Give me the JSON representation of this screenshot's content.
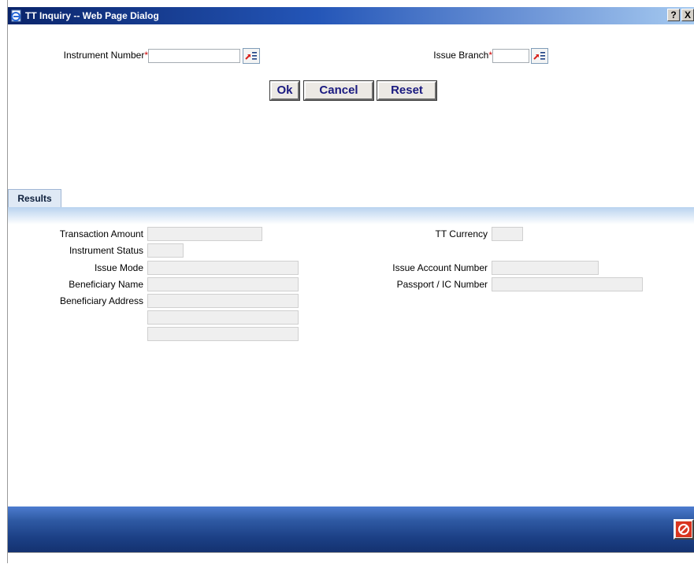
{
  "window": {
    "title": "TT Inquiry -- Web Page Dialog",
    "help_label": "?",
    "close_label": "X"
  },
  "query": {
    "instrument_number_label": "Instrument Number",
    "issue_branch_label": "Issue Branch",
    "required_marker": "*",
    "instrument_number_value": "",
    "issue_branch_value": ""
  },
  "buttons": {
    "ok": "Ok",
    "cancel": "Cancel",
    "reset": "Reset"
  },
  "tabs": {
    "results": "Results"
  },
  "results": {
    "transaction_amount_label": "Transaction Amount",
    "instrument_status_label": "Instrument Status",
    "issue_mode_label": "Issue Mode",
    "beneficiary_name_label": "Beneficiary Name",
    "beneficiary_address_label": "Beneficiary Address",
    "tt_currency_label": "TT Currency",
    "issue_account_number_label": "Issue Account Number",
    "passport_ic_number_label": "Passport / IC Number"
  },
  "icons": {
    "window": "ie-page-icon",
    "lov": "list-of-values-icon",
    "exit": "exit-icon"
  },
  "colors": {
    "titlebar": "#0a246a",
    "footer": "#1b3f84",
    "required": "#cc0000",
    "button_text": "#1a1a80"
  }
}
